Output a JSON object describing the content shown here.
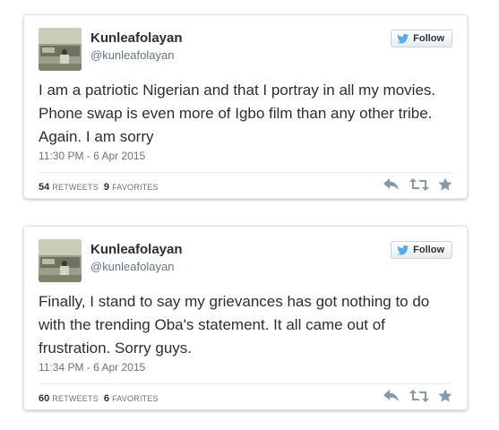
{
  "tweets": [
    {
      "name": "Kunleafolayan",
      "handle": "@kunleafolayan",
      "follow_label": "Follow",
      "text": "I am a patriotic Nigerian and that I portray in all my movies. Phone swap is even more of Igbo film than any other tribe. Again. I am sorry",
      "timestamp": "11:30 PM - 6 Apr 2015",
      "retweets_count": "54",
      "retweets_label": "RETWEETS",
      "favorites_count": "9",
      "favorites_label": "FAVORITES"
    },
    {
      "name": "Kunleafolayan",
      "handle": "@kunleafolayan",
      "follow_label": "Follow",
      "text": "Finally, I stand to say my grievances has got nothing to do with the trending Oba's statement. It all came out of frustration. Sorry guys.",
      "timestamp": "11:34 PM - 6 Apr 2015",
      "retweets_count": "60",
      "retweets_label": "RETWEETS",
      "favorites_count": "6",
      "favorites_label": "FAVORITES"
    }
  ],
  "icons": {
    "follow": "twitter-bird-icon",
    "reply": "reply-icon",
    "retweet": "retweet-icon",
    "favorite": "star-icon"
  },
  "colors": {
    "brand_blue": "#55acee",
    "text": "#292f33",
    "muted": "#66757f",
    "action_icon": "#8899a6"
  }
}
